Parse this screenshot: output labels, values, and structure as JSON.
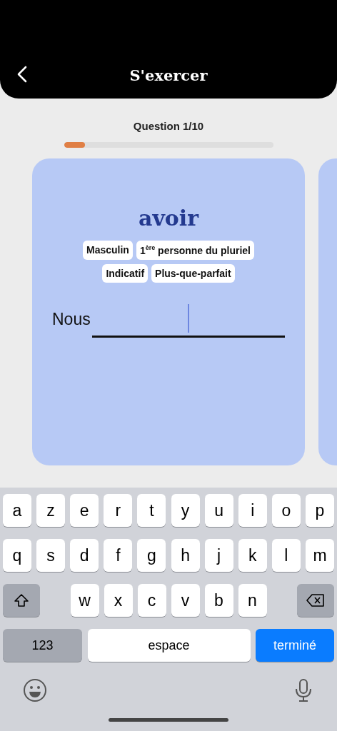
{
  "header": {
    "title": "S'exercer"
  },
  "progress": {
    "label": "Question 1/10",
    "level": 0.1
  },
  "card": {
    "verb": "avoir",
    "tags": [
      "Masculin",
      "1$^{ère}$ personne du pluriel",
      "Indicatif",
      "Plus-que-parfait"
    ],
    "pronoun": "Nous",
    "answer": {
      "focused": true
    }
  },
  "keyboard": {
    "rows": [
      {
        "keys": [
          {
            "kind": "letter",
            "label": "a"
          },
          {
            "kind": "letter",
            "label": "z"
          },
          {
            "kind": "letter",
            "label": "e"
          },
          {
            "kind": "letter",
            "label": "r"
          },
          {
            "kind": "letter",
            "label": "t"
          },
          {
            "kind": "letter",
            "label": "y"
          },
          {
            "kind": "letter",
            "label": "u"
          },
          {
            "kind": "letter",
            "label": "i"
          },
          {
            "kind": "letter",
            "label": "o"
          },
          {
            "kind": "letter",
            "label": "p"
          }
        ]
      },
      {
        "keys": [
          {
            "kind": "letter",
            "label": "q"
          },
          {
            "kind": "letter",
            "label": "s"
          },
          {
            "kind": "letter",
            "label": "d"
          },
          {
            "kind": "letter",
            "label": "f"
          },
          {
            "kind": "letter",
            "label": "g"
          },
          {
            "kind": "letter",
            "label": "h"
          },
          {
            "kind": "letter",
            "label": "j"
          },
          {
            "kind": "letter",
            "label": "k"
          },
          {
            "kind": "letter",
            "label": "l"
          },
          {
            "kind": "letter",
            "label": "m"
          }
        ]
      },
      {
        "keys": [
          {
            "kind": "shift"
          },
          {
            "kind": "letter",
            "label": "w"
          },
          {
            "kind": "letter",
            "label": "x"
          },
          {
            "kind": "letter",
            "label": "c"
          },
          {
            "kind": "letter",
            "label": "v"
          },
          {
            "kind": "letter",
            "label": "b"
          },
          {
            "kind": "letter",
            "label": "n"
          },
          {
            "kind": "delete"
          }
        ]
      },
      {
        "keys": [
          {
            "kind": "numbers",
            "label": "123"
          },
          {
            "kind": "space",
            "label": "espace"
          },
          {
            "kind": "done",
            "label": "terminé"
          }
        ]
      }
    ]
  }
}
